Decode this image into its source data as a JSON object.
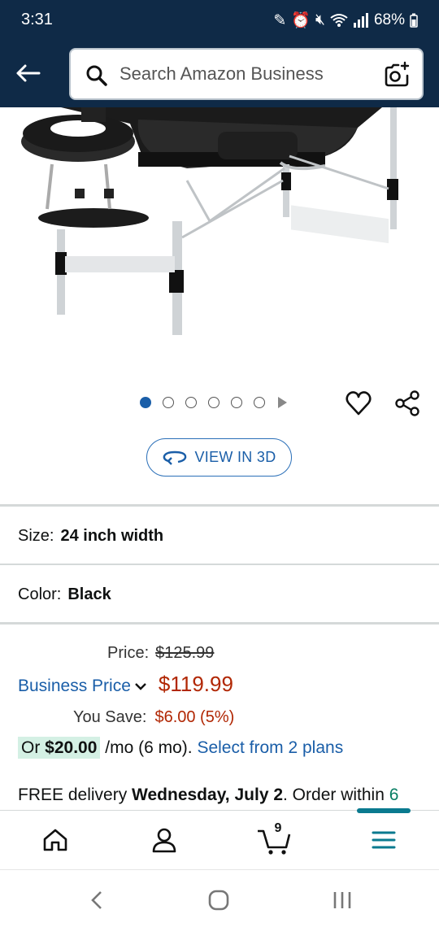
{
  "status_bar": {
    "time": "3:31",
    "battery": "68%"
  },
  "search": {
    "placeholder": "Search Amazon Business"
  },
  "carousel": {
    "total_dots": 6,
    "active_index": 0
  },
  "view3d": {
    "label": "VIEW IN 3D"
  },
  "variations": {
    "size_label": "Size:",
    "size_value": "24 inch width",
    "color_label": "Color:",
    "color_value": "Black"
  },
  "pricing": {
    "price_label": "Price:",
    "list_price": "$125.99",
    "business_label": "Business Price",
    "business_price": "$119.99",
    "save_label": "You Save:",
    "save_value": "$6.00 (5%)"
  },
  "installment": {
    "prefix": "Or",
    "amount": "$20.00",
    "terms": "/mo (6 mo).",
    "link": "Select from 2 plans"
  },
  "delivery": {
    "prefix": "FREE delivery",
    "date": "Wednesday, July 2",
    "suffix": ". Order within",
    "countdown": "6"
  },
  "bottom_nav": {
    "cart_count": "9"
  },
  "colors": {
    "header_bg": "#0f2a47",
    "link_blue": "#1a5ea8",
    "price_red": "#b12704",
    "accent_teal": "#0a7a8f"
  }
}
